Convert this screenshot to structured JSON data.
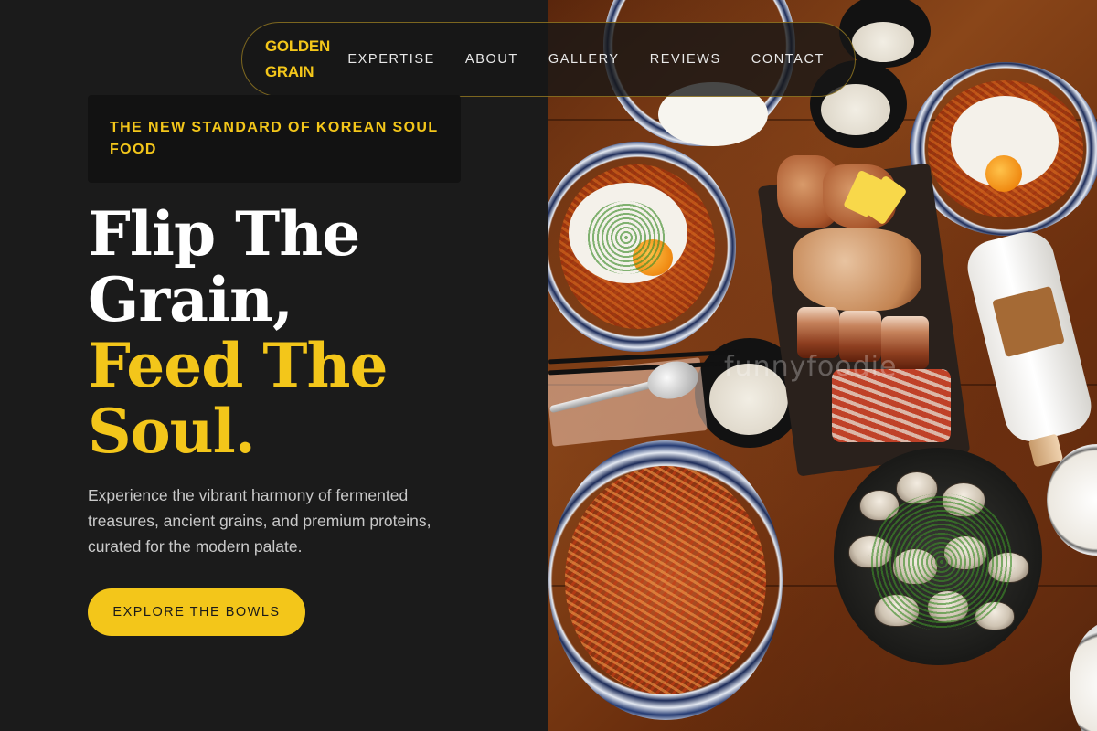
{
  "brand": {
    "line1": "GOLDEN",
    "line2": "GRAIN"
  },
  "nav": {
    "links": [
      {
        "label": "EXPERTISE"
      },
      {
        "label": "ABOUT"
      },
      {
        "label": "GALLERY"
      },
      {
        "label": "REVIEWS"
      },
      {
        "label": "CONTACT"
      }
    ]
  },
  "hero": {
    "tagline": "THE NEW STANDARD OF KOREAN SOUL FOOD",
    "headline_line1": "Flip The",
    "headline_line2": "Grain,",
    "headline_line3": "Feed The",
    "headline_line4": "Soul.",
    "description": "Experience the vibrant harmony of fermented treasures, ancient grains, and premium proteins, curated for the modern palate.",
    "cta_label": "EXPLORE THE BOWLS"
  },
  "photo": {
    "watermark": "funnyfoodie"
  },
  "colors": {
    "background": "#1b1b1b",
    "accent": "#f3c61a",
    "text_primary": "#ffffff",
    "text_secondary": "#c9c9c9"
  }
}
